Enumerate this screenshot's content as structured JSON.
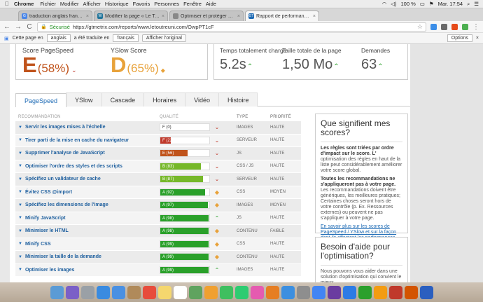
{
  "menubar": {
    "apple": "",
    "items": [
      "Chrome",
      "Fichier",
      "Modifier",
      "Afficher",
      "Historique",
      "Favoris",
      "Personnes",
      "Fenêtre",
      "Aide"
    ],
    "battery": "100 %",
    "clock": "Mar. 17:54"
  },
  "tabs": [
    {
      "label": "traduction anglais français - Google",
      "favicon_color": "#4a86e8",
      "favicon": "G",
      "active": false
    },
    {
      "label": "Modifier la page « Le Tout Réunis »",
      "favicon_color": "#21759b",
      "favicon": "W",
      "active": false
    },
    {
      "label": "Optimiser et protéger son site",
      "favicon_color": "#888888",
      "favicon": "",
      "active": false
    },
    {
      "label": "Rapport de performance le plus",
      "favicon_color": "#1e6bb5",
      "favicon": "GT",
      "active": true
    }
  ],
  "address": {
    "secure_label": "Sécurisé",
    "url": "https://gtmetrix.com/reports/www.letoutreuni.com/OwpPT1cF"
  },
  "translate": {
    "prefix": "Cette page en",
    "from_lang": "anglais",
    "middle": "a été traduite en",
    "to_lang": "français",
    "show_original": "Afficher l'original",
    "options": "Options"
  },
  "scores": {
    "pagespeed_label": "Score PageSpeed",
    "pagespeed_grade": "E",
    "pagespeed_pct": "(58%)",
    "yslow_label": "YSlow Score",
    "yslow_grade": "D",
    "yslow_pct": "(65%)"
  },
  "details": {
    "load_label": "Temps totalement chargé",
    "load_value": "5.2s",
    "size_label": "Taille totale de la page",
    "size_value": "1,50 Mo",
    "req_label": "Demandes",
    "req_value": "63"
  },
  "page_tabs": [
    "PageSpeed",
    "YSlow",
    "Cascade",
    "Horaires",
    "Vidéo",
    "Histoire"
  ],
  "table": {
    "headers": {
      "rec": "RECOMMANDATION",
      "quality": "QUALITÉ",
      "type": "TYPE",
      "priority": "PRIORITÉ"
    },
    "rows": [
      {
        "name": "Servir les images mises à l'échelle",
        "grade": "F (0)",
        "score": 0,
        "color": "#ffffff",
        "indicator": "down",
        "type": "IMAGES",
        "priority": "HAUTE"
      },
      {
        "name": "Tirer parti de la mise en cache du navigateur",
        "grade": "F (22)",
        "score": 22,
        "color": "#c0392b",
        "indicator": "down",
        "type": "SERVEUR",
        "priority": "HAUTE"
      },
      {
        "name": "Supprimer l'analyse de JavaScript",
        "grade": "E (56)",
        "score": 56,
        "color": "#c0531b",
        "indicator": "down",
        "type": "JS",
        "priority": "HAUTE"
      },
      {
        "name": "Optimiser l'ordre des styles et des scripts",
        "grade": "B (83)",
        "score": 83,
        "color": "#76b82a",
        "indicator": "down",
        "type": "CSS / JS",
        "priority": "HAUTE"
      },
      {
        "name": "Spécifiez un validateur de cache",
        "grade": "B (87)",
        "score": 87,
        "color": "#76b82a",
        "indicator": "down",
        "type": "SERVEUR",
        "priority": "HAUTE"
      },
      {
        "name": "Évitez CSS @import",
        "grade": "A (92)",
        "score": 92,
        "color": "#2aa02a",
        "indicator": "diamond",
        "type": "CSS",
        "priority": "MOYEN"
      },
      {
        "name": "Spécifiez les dimensions de l'image",
        "grade": "A (97)",
        "score": 97,
        "color": "#2aa02a",
        "indicator": "diamond",
        "type": "IMAGES",
        "priority": "MOYEN"
      },
      {
        "name": "Minify JavaScript",
        "grade": "A (98)",
        "score": 98,
        "color": "#2aa02a",
        "indicator": "up",
        "type": "JS",
        "priority": "HAUTE"
      },
      {
        "name": "Minimiser le HTML",
        "grade": "A (98)",
        "score": 98,
        "color": "#2aa02a",
        "indicator": "diamond",
        "type": "CONTENU",
        "priority": "FAIBLE"
      },
      {
        "name": "Minify CSS",
        "grade": "A (99)",
        "score": 99,
        "color": "#2aa02a",
        "indicator": "diamond",
        "type": "CSS",
        "priority": "HAUTE"
      },
      {
        "name": "Minimiser la taille de la demande",
        "grade": "A (99)",
        "score": 99,
        "color": "#2aa02a",
        "indicator": "diamond",
        "type": "CONTENU",
        "priority": "HAUTE"
      },
      {
        "name": "Optimiser les images",
        "grade": "A (99)",
        "score": 99,
        "color": "#2aa02a",
        "indicator": "up",
        "type": "IMAGES",
        "priority": "HAUTE"
      }
    ]
  },
  "sidebar": {
    "title": "Que signifient mes scores?",
    "p1_bold": "Les règles sont triées par ordre d'impact sur le score. L'",
    "p1_text": "optimisation des règles en haut de la liste peut considérablement améliorer votre score global.",
    "p2_bold": "Toutes les recommandations ne s'appliqueront pas à votre page.",
    "p2_text": "Les recommandations doivent être génériques, les meilleures pratiques; Certaines choses seront hors de votre contrôle (p. Ex. Ressources externes) ou peuvent ne pas s'appliquer à votre page.",
    "link": "En savoir plus sur les scores de PageSpeed / YSlow et sur la façon dont ils affectent les performances.",
    "help_title": "Besoin d'aide pour l'optimisation?",
    "help_text": "Nous pouvons vous aider dans une solution d'optimisation qui convient le mieux."
  },
  "colors": {
    "grade_e": "#c0531b",
    "grade_d": "#e8a23a",
    "link": "#1e6bb5",
    "good": "#2aa02a"
  },
  "dock_icons": [
    "finder-icon",
    "siri-icon",
    "launchpad-icon",
    "safari-icon",
    "mail-icon",
    "contacts-icon",
    "calendar-icon",
    "notes-icon",
    "reminders-icon",
    "maps-icon",
    "photos-icon",
    "messages-icon",
    "facetime-icon",
    "itunes-icon",
    "ibooks-icon",
    "appstore-icon",
    "preferences-icon",
    "chrome-icon",
    "imovie-icon",
    "keynote-icon",
    "numbers-icon",
    "pages-icon",
    "filezilla-icon",
    "powerpoint-icon",
    "word-icon"
  ]
}
